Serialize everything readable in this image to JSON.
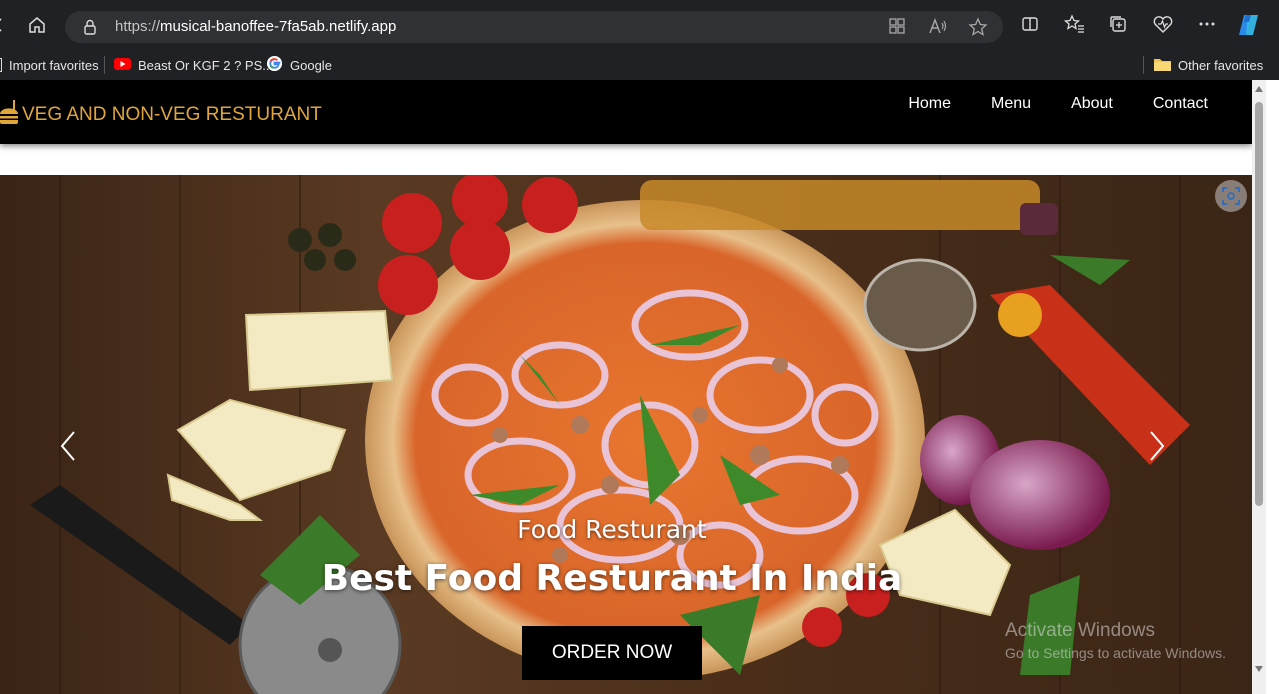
{
  "browser": {
    "url_prefix": "https://",
    "url_domain": "musical-banoffee-7fa5ab.netlify.app",
    "favorites": [
      {
        "label": "Import favorites"
      },
      {
        "label": "Beast Or KGF 2 ? PS..."
      },
      {
        "label": "Google"
      }
    ],
    "other_favorites": "Other favorites"
  },
  "site": {
    "brand": "VEG AND NON-VEG RESTURANT",
    "nav": [
      "Home",
      "Menu",
      "About",
      "Contact"
    ]
  },
  "hero": {
    "subtitle": "Food Resturant",
    "title": "Best Food Resturant In India",
    "button": "ORDER NOW"
  },
  "watermark": {
    "line1": "Activate Windows",
    "line2": "Go to Settings to activate Windows."
  },
  "colors": {
    "brand": "#e0a63a",
    "nav_bg": "#000000",
    "browser_chrome": "#202124"
  }
}
